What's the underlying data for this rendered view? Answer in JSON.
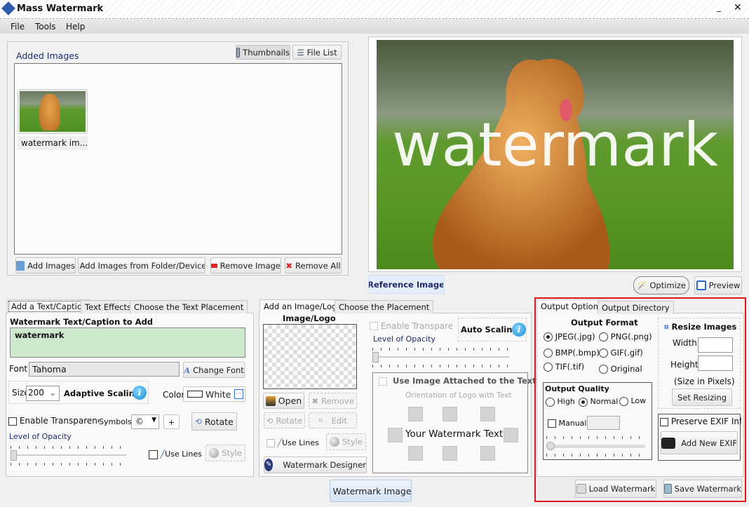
{
  "window": {
    "title": "Mass Watermark"
  },
  "menu": [
    "File",
    "Tools",
    "Help"
  ],
  "added_images": {
    "title": "Added Images",
    "view_thumbnails": "Thumbnails",
    "view_file_list": "File List",
    "items": [
      {
        "label": "watermark im..."
      }
    ],
    "buttons": {
      "add": "Add Images",
      "add_folder": "Add Images from Folder/Device",
      "remove": "Remove Image",
      "remove_all": "Remove All"
    }
  },
  "preview": {
    "watermark_text": "watermark",
    "reference_tab": "Reference Image",
    "optimize": "Optimize",
    "preview": "Preview"
  },
  "text_panel": {
    "tabs": [
      "Add a Text/Caption",
      "Text Effects",
      "Choose the Text Placement"
    ],
    "heading": "Watermark Text/Caption to Add",
    "text_value": "watermark",
    "font_label": "Font",
    "font_value": "Tahoma",
    "change_font": "Change Font",
    "size_label": "Size",
    "size_value": "200",
    "adaptive_scaling": "Adaptive Scaling",
    "color_label": "Color",
    "color_value": "White",
    "enable_transparency": "Enable Transparency",
    "symbols_label": "Symbols",
    "symbol_value": "©",
    "add_symbol": "+",
    "rotate": "Rotate",
    "opacity_label": "Level of Opacity",
    "use_lines": "Use Lines",
    "style": "Style"
  },
  "logo_panel": {
    "tabs": [
      "Add an Image/Logo",
      "Choose the Placement"
    ],
    "heading": "Image/Logo",
    "open": "Open",
    "remove": "Remove",
    "rotate": "Rotate",
    "edit": "Edit",
    "use_lines": "Use Lines",
    "style": "Style",
    "designer": "Watermark Designer",
    "enable_transparency": "Enable Transparency",
    "auto_scaling": "Auto Scaling",
    "opacity_label": "Level of Opacity",
    "attach_label": "Use Image Attached to the Text",
    "orientation_label": "Orientation of Logo with Text",
    "sample_text": "Your Watermark Text"
  },
  "watermark_image_button": "Watermark Image",
  "output": {
    "tabs": [
      "Output Options",
      "Output Directory"
    ],
    "format_heading": "Output Format",
    "formats": [
      {
        "label": "JPEG(.jpg)",
        "selected": true
      },
      {
        "label": "PNG(.png)",
        "selected": false
      },
      {
        "label": "BMP(.bmp)",
        "selected": false
      },
      {
        "label": "GIF(.gif)",
        "selected": false
      },
      {
        "label": "TIF(.tif)",
        "selected": false
      },
      {
        "label": "Original",
        "selected": false
      }
    ],
    "quality_heading": "Output Quality",
    "qualities": [
      {
        "label": "High",
        "selected": false
      },
      {
        "label": "Normal",
        "selected": true
      },
      {
        "label": "Low",
        "selected": false
      }
    ],
    "manual": "Manual",
    "resize_heading": "Resize Images",
    "width_label": "Width:",
    "height_label": "Height:",
    "size_note": "(Size in Pixels)",
    "set_resizing": "Set Resizing",
    "preserve_exif": "Preserve EXIF Info",
    "add_exif": "Add New EXIF",
    "load_watermark": "Load Watermark",
    "save_watermark": "Save Watermark"
  },
  "colors": {
    "highlight": "#e0161b",
    "text_area_bg": "#cde8cd",
    "heading_blue": "#1f2a6b"
  }
}
